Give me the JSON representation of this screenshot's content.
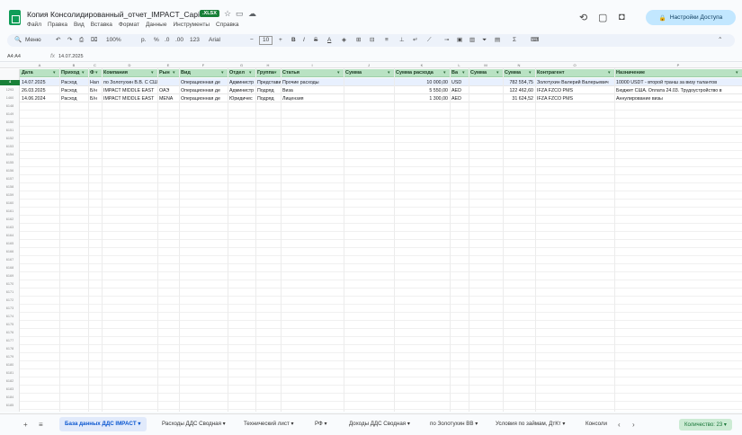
{
  "app": {
    "title": "Копия Консолидированный_отчет_IMPACT_Capital",
    "badge": ".XLSX",
    "share_label": "Настройки Доступа"
  },
  "menu": [
    "Файл",
    "Правка",
    "Вид",
    "Вставка",
    "Формат",
    "Данные",
    "Инструменты",
    "Справка"
  ],
  "toolbar": {
    "search_label": "Меню",
    "zoom": "100%",
    "currency": "р.",
    "percent": "%",
    "dec_less": ".0",
    "dec_more": ".00",
    "number_format": "123",
    "font": "Arial",
    "font_size": "10",
    "bold": "B",
    "italic": "I",
    "strike": "S",
    "text_color": "A"
  },
  "formula_bar": {
    "cell_ref": "А4:А4",
    "fx": "fx",
    "value": "14.07.2025"
  },
  "columns": [
    "Дата",
    "Приход",
    "Ф",
    "Компания",
    "Рын",
    "Вид",
    "Отдел",
    "Группа",
    "Статья",
    "Сумма",
    "Сумма расхода",
    "Ва",
    "Сумма",
    "Сумма",
    "Контрагент",
    "Назначение"
  ],
  "col_letters": [
    "A",
    "B",
    "C",
    "D",
    "E",
    "F",
    "G",
    "H",
    "I",
    "J",
    "K",
    "L",
    "M",
    "N",
    "O",
    "P"
  ],
  "rows": [
    {
      "num": "4",
      "cells": [
        "14.07.2025",
        "Расход",
        "Нал",
        "по Золотухин В.В. С США",
        "",
        "Операционная де",
        "Администр",
        "Представит",
        "Прочие расходы",
        "",
        "10 000,00",
        "USD",
        "",
        "782 554,75",
        "Золотухин Валерий Валерьевич",
        "10000 USDT - второй транш за визу талантов"
      ]
    },
    {
      "num": "1293",
      "cells": [
        "26.03.2025",
        "Расход",
        "Б/н",
        "IMPACT MIDDLE EAST",
        "ОАЭ",
        "Операционная де",
        "Администр",
        "Подряд",
        "Виза",
        "",
        "5 550,00",
        "AED",
        "",
        "122 462,60",
        "IFZA FZCO PMS",
        "Бюджет США. Оплата 24.03. Трудоустройство в"
      ]
    },
    {
      "num": "1460",
      "cells": [
        "14.06.2024",
        "Расход",
        "Б/н",
        "IMPACT MIDDLE EAST",
        "MENA",
        "Операционная де",
        "Юридичес",
        "Подряд",
        "Лицензия",
        "",
        "1 300,00",
        "AED",
        "",
        "31 624,52",
        "IFZA FZCO PMS",
        "Аннулирование визы"
      ]
    }
  ],
  "empty_row_numbers": [
    "6148",
    "6149",
    "6150",
    "6151",
    "6152",
    "6153",
    "6154",
    "6155",
    "6156",
    "6157",
    "6158",
    "6159",
    "6160",
    "6161",
    "6162",
    "6163",
    "6164",
    "6165",
    "6166",
    "6167",
    "6168",
    "6169",
    "6170",
    "6171",
    "6172",
    "6173",
    "6174",
    "6175",
    "6176",
    "6177",
    "6178",
    "6179",
    "6180",
    "6181",
    "6182",
    "6183",
    "6184",
    "6185",
    "6186",
    "6187"
  ],
  "sheets": [
    "База данных ДДС IMPACT",
    "Расходы ДДС Сводная",
    "Технический лист",
    "РФ",
    "Доходы ДДС Сводная",
    "по Золотухин ВВ",
    "Условия по займам, ДтКт",
    "Консоли"
  ],
  "count_label": "Количество: 23",
  "colors": {
    "header_green": "#b9e2c3",
    "active_tab": "#e1eafb",
    "share": "#c2e7ff",
    "badge": "#188038"
  }
}
